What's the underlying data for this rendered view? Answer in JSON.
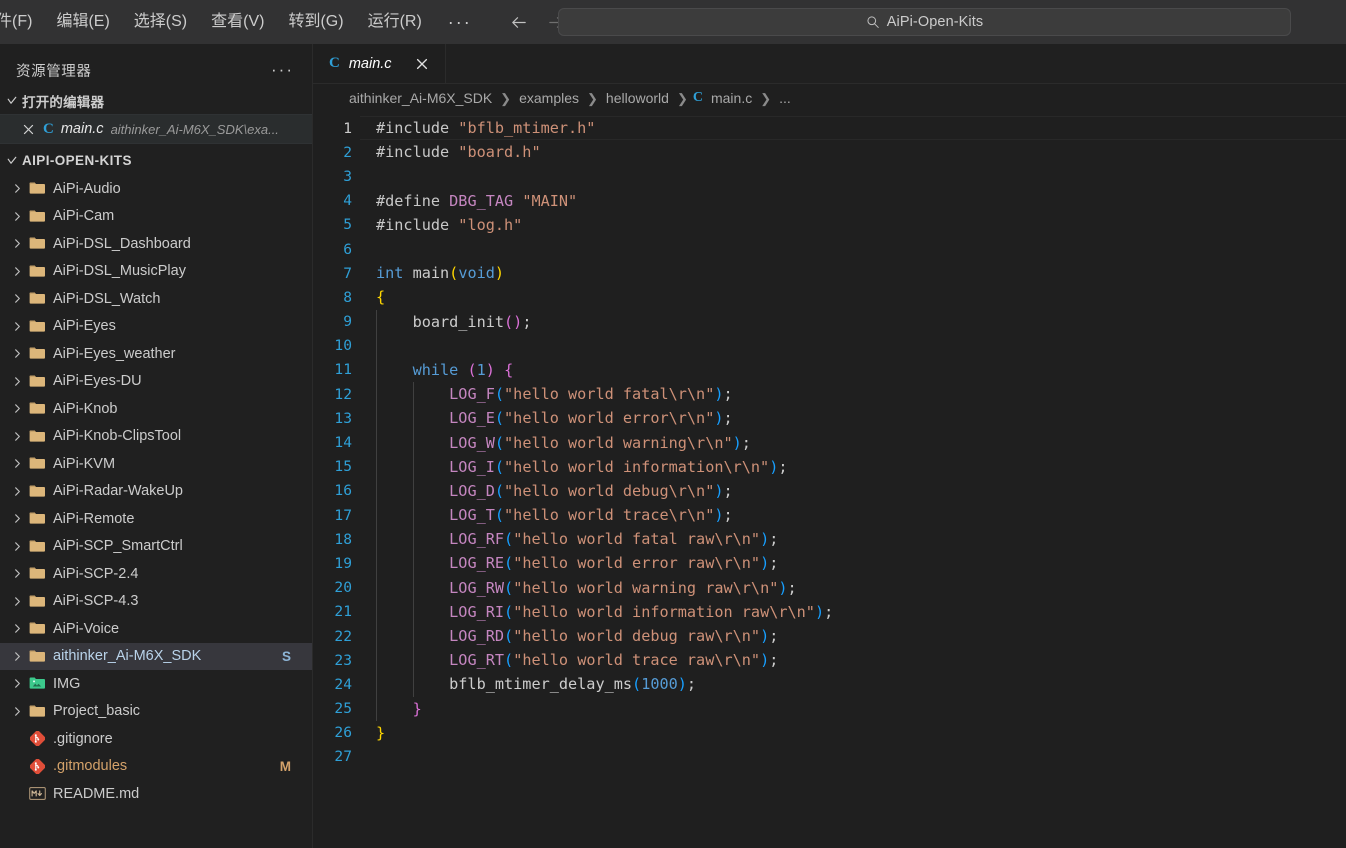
{
  "titlebar": {
    "menus": [
      "件(F)",
      "编辑(E)",
      "选择(S)",
      "查看(V)",
      "转到(G)",
      "运行(R)"
    ],
    "overflow_label": "···",
    "back_icon": "arrow-left-icon",
    "forward_icon": "arrow-right-icon",
    "search": {
      "icon": "search-icon",
      "value": "AiPi-Open-Kits"
    }
  },
  "sidebar": {
    "title": "资源管理器",
    "actions_label": "···",
    "open_editors": {
      "label": "打开的编辑器",
      "items": [
        {
          "name": "main.c",
          "description": "aithinker_Ai-M6X_SDK\\exa...",
          "icon": "c-file-icon",
          "close_icon": "close-icon"
        }
      ]
    },
    "workspace": {
      "label": "AIPI-OPEN-KITS",
      "items": [
        {
          "label": "AiPi-Audio",
          "type": "folder",
          "badge": ""
        },
        {
          "label": "AiPi-Cam",
          "type": "folder",
          "badge": ""
        },
        {
          "label": "AiPi-DSL_Dashboard",
          "type": "folder",
          "badge": ""
        },
        {
          "label": "AiPi-DSL_MusicPlay",
          "type": "folder",
          "badge": ""
        },
        {
          "label": "AiPi-DSL_Watch",
          "type": "folder",
          "badge": ""
        },
        {
          "label": "AiPi-Eyes",
          "type": "folder",
          "badge": ""
        },
        {
          "label": "AiPi-Eyes_weather",
          "type": "folder",
          "badge": ""
        },
        {
          "label": "AiPi-Eyes-DU",
          "type": "folder",
          "badge": ""
        },
        {
          "label": "AiPi-Knob",
          "type": "folder",
          "badge": ""
        },
        {
          "label": "AiPi-Knob-ClipsTool",
          "type": "folder",
          "badge": ""
        },
        {
          "label": "AiPi-KVM",
          "type": "folder",
          "badge": ""
        },
        {
          "label": "AiPi-Radar-WakeUp",
          "type": "folder",
          "badge": ""
        },
        {
          "label": "AiPi-Remote",
          "type": "folder",
          "badge": ""
        },
        {
          "label": "AiPi-SCP_SmartCtrl",
          "type": "folder",
          "badge": ""
        },
        {
          "label": "AiPi-SCP-2.4",
          "type": "folder",
          "badge": ""
        },
        {
          "label": "AiPi-SCP-4.3",
          "type": "folder",
          "badge": ""
        },
        {
          "label": "AiPi-Voice",
          "type": "folder",
          "badge": ""
        },
        {
          "label": "aithinker_Ai-M6X_SDK",
          "type": "folder",
          "badge": "S",
          "selected": true
        },
        {
          "label": "IMG",
          "type": "imgfolder",
          "badge": ""
        },
        {
          "label": "Project_basic",
          "type": "folder",
          "badge": ""
        },
        {
          "label": ".gitignore",
          "type": "git",
          "badge": ""
        },
        {
          "label": ".gitmodules",
          "type": "git",
          "badge": "M",
          "modified": true
        },
        {
          "label": "README.md",
          "type": "markdown",
          "badge": ""
        }
      ]
    }
  },
  "editor": {
    "tabs": [
      {
        "label": "main.c",
        "icon": "c-file-icon",
        "close_icon": "close-icon",
        "active": true
      }
    ],
    "breadcrumb": [
      "aithinker_Ai-M6X_SDK",
      "examples",
      "helloworld",
      "main.c",
      "..."
    ],
    "breadcrumb_separator": "❯",
    "line_count": 27,
    "lines": [
      {
        "n": 1,
        "tokens": [
          {
            "t": "#include ",
            "c": "t-dir"
          },
          {
            "t": "\"bflb_mtimer.h\"",
            "c": "t-str"
          }
        ]
      },
      {
        "n": 2,
        "tokens": [
          {
            "t": "#include ",
            "c": "t-dir"
          },
          {
            "t": "\"board.h\"",
            "c": "t-str"
          }
        ]
      },
      {
        "n": 3,
        "tokens": []
      },
      {
        "n": 4,
        "tokens": [
          {
            "t": "#define ",
            "c": "t-dir"
          },
          {
            "t": "DBG_TAG",
            "c": "t-pre"
          },
          {
            "t": " ",
            "c": "t-plain"
          },
          {
            "t": "\"MAIN\"",
            "c": "t-str"
          }
        ]
      },
      {
        "n": 5,
        "tokens": [
          {
            "t": "#include ",
            "c": "t-dir"
          },
          {
            "t": "\"log.h\"",
            "c": "t-str"
          }
        ]
      },
      {
        "n": 6,
        "tokens": []
      },
      {
        "n": 7,
        "tokens": [
          {
            "t": "int",
            "c": "t-key"
          },
          {
            "t": " main",
            "c": "t-plain"
          },
          {
            "t": "(",
            "c": "t-paren1"
          },
          {
            "t": "void",
            "c": "t-key"
          },
          {
            "t": ")",
            "c": "t-paren1"
          }
        ]
      },
      {
        "n": 8,
        "tokens": [
          {
            "t": "{",
            "c": "t-paren1"
          }
        ]
      },
      {
        "n": 9,
        "tokens": [
          {
            "t": "    board_init",
            "c": "t-plain"
          },
          {
            "t": "(",
            "c": "t-paren2"
          },
          {
            "t": ")",
            "c": "t-paren2"
          },
          {
            "t": ";",
            "c": "t-plain"
          }
        ]
      },
      {
        "n": 10,
        "tokens": []
      },
      {
        "n": 11,
        "tokens": [
          {
            "t": "    ",
            "c": "t-plain"
          },
          {
            "t": "while",
            "c": "t-key"
          },
          {
            "t": " ",
            "c": "t-plain"
          },
          {
            "t": "(",
            "c": "t-paren2"
          },
          {
            "t": "1",
            "c": "t-num"
          },
          {
            "t": ")",
            "c": "t-paren2"
          },
          {
            "t": " ",
            "c": "t-plain"
          },
          {
            "t": "{",
            "c": "t-paren2"
          }
        ]
      },
      {
        "n": 12,
        "tokens": [
          {
            "t": "        ",
            "c": "t-plain"
          },
          {
            "t": "LOG_F",
            "c": "t-macro"
          },
          {
            "t": "(",
            "c": "t-paren3"
          },
          {
            "t": "\"hello world fatal\\r\\n\"",
            "c": "t-str"
          },
          {
            "t": ")",
            "c": "t-paren3"
          },
          {
            "t": ";",
            "c": "t-plain"
          }
        ]
      },
      {
        "n": 13,
        "tokens": [
          {
            "t": "        ",
            "c": "t-plain"
          },
          {
            "t": "LOG_E",
            "c": "t-macro"
          },
          {
            "t": "(",
            "c": "t-paren3"
          },
          {
            "t": "\"hello world error\\r\\n\"",
            "c": "t-str"
          },
          {
            "t": ")",
            "c": "t-paren3"
          },
          {
            "t": ";",
            "c": "t-plain"
          }
        ]
      },
      {
        "n": 14,
        "tokens": [
          {
            "t": "        ",
            "c": "t-plain"
          },
          {
            "t": "LOG_W",
            "c": "t-macro"
          },
          {
            "t": "(",
            "c": "t-paren3"
          },
          {
            "t": "\"hello world warning\\r\\n\"",
            "c": "t-str"
          },
          {
            "t": ")",
            "c": "t-paren3"
          },
          {
            "t": ";",
            "c": "t-plain"
          }
        ]
      },
      {
        "n": 15,
        "tokens": [
          {
            "t": "        ",
            "c": "t-plain"
          },
          {
            "t": "LOG_I",
            "c": "t-macro"
          },
          {
            "t": "(",
            "c": "t-paren3"
          },
          {
            "t": "\"hello world information\\r\\n\"",
            "c": "t-str"
          },
          {
            "t": ")",
            "c": "t-paren3"
          },
          {
            "t": ";",
            "c": "t-plain"
          }
        ]
      },
      {
        "n": 16,
        "tokens": [
          {
            "t": "        ",
            "c": "t-plain"
          },
          {
            "t": "LOG_D",
            "c": "t-macro"
          },
          {
            "t": "(",
            "c": "t-paren3"
          },
          {
            "t": "\"hello world debug\\r\\n\"",
            "c": "t-str"
          },
          {
            "t": ")",
            "c": "t-paren3"
          },
          {
            "t": ";",
            "c": "t-plain"
          }
        ]
      },
      {
        "n": 17,
        "tokens": [
          {
            "t": "        ",
            "c": "t-plain"
          },
          {
            "t": "LOG_T",
            "c": "t-macro"
          },
          {
            "t": "(",
            "c": "t-paren3"
          },
          {
            "t": "\"hello world trace\\r\\n\"",
            "c": "t-str"
          },
          {
            "t": ")",
            "c": "t-paren3"
          },
          {
            "t": ";",
            "c": "t-plain"
          }
        ]
      },
      {
        "n": 18,
        "tokens": [
          {
            "t": "        ",
            "c": "t-plain"
          },
          {
            "t": "LOG_RF",
            "c": "t-macro"
          },
          {
            "t": "(",
            "c": "t-paren3"
          },
          {
            "t": "\"hello world fatal raw\\r\\n\"",
            "c": "t-str"
          },
          {
            "t": ")",
            "c": "t-paren3"
          },
          {
            "t": ";",
            "c": "t-plain"
          }
        ]
      },
      {
        "n": 19,
        "tokens": [
          {
            "t": "        ",
            "c": "t-plain"
          },
          {
            "t": "LOG_RE",
            "c": "t-macro"
          },
          {
            "t": "(",
            "c": "t-paren3"
          },
          {
            "t": "\"hello world error raw\\r\\n\"",
            "c": "t-str"
          },
          {
            "t": ")",
            "c": "t-paren3"
          },
          {
            "t": ";",
            "c": "t-plain"
          }
        ]
      },
      {
        "n": 20,
        "tokens": [
          {
            "t": "        ",
            "c": "t-plain"
          },
          {
            "t": "LOG_RW",
            "c": "t-macro"
          },
          {
            "t": "(",
            "c": "t-paren3"
          },
          {
            "t": "\"hello world warning raw\\r\\n\"",
            "c": "t-str"
          },
          {
            "t": ")",
            "c": "t-paren3"
          },
          {
            "t": ";",
            "c": "t-plain"
          }
        ]
      },
      {
        "n": 21,
        "tokens": [
          {
            "t": "        ",
            "c": "t-plain"
          },
          {
            "t": "LOG_RI",
            "c": "t-macro"
          },
          {
            "t": "(",
            "c": "t-paren3"
          },
          {
            "t": "\"hello world information raw\\r\\n\"",
            "c": "t-str"
          },
          {
            "t": ")",
            "c": "t-paren3"
          },
          {
            "t": ";",
            "c": "t-plain"
          }
        ]
      },
      {
        "n": 22,
        "tokens": [
          {
            "t": "        ",
            "c": "t-plain"
          },
          {
            "t": "LOG_RD",
            "c": "t-macro"
          },
          {
            "t": "(",
            "c": "t-paren3"
          },
          {
            "t": "\"hello world debug raw\\r\\n\"",
            "c": "t-str"
          },
          {
            "t": ")",
            "c": "t-paren3"
          },
          {
            "t": ";",
            "c": "t-plain"
          }
        ]
      },
      {
        "n": 23,
        "tokens": [
          {
            "t": "        ",
            "c": "t-plain"
          },
          {
            "t": "LOG_RT",
            "c": "t-macro"
          },
          {
            "t": "(",
            "c": "t-paren3"
          },
          {
            "t": "\"hello world trace raw\\r\\n\"",
            "c": "t-str"
          },
          {
            "t": ")",
            "c": "t-paren3"
          },
          {
            "t": ";",
            "c": "t-plain"
          }
        ]
      },
      {
        "n": 24,
        "tokens": [
          {
            "t": "        bflb_mtimer_delay_ms",
            "c": "t-plain"
          },
          {
            "t": "(",
            "c": "t-paren3"
          },
          {
            "t": "1000",
            "c": "t-num"
          },
          {
            "t": ")",
            "c": "t-paren3"
          },
          {
            "t": ";",
            "c": "t-plain"
          }
        ]
      },
      {
        "n": 25,
        "tokens": [
          {
            "t": "    ",
            "c": "t-plain"
          },
          {
            "t": "}",
            "c": "t-paren2"
          }
        ]
      },
      {
        "n": 26,
        "tokens": [
          {
            "t": "}",
            "c": "t-paren1"
          }
        ]
      },
      {
        "n": 27,
        "tokens": []
      }
    ]
  },
  "colors": {
    "background": "#1f1f1f",
    "sidebar_bg": "#202020",
    "titlebar_bg": "#323233",
    "accent_blue": "#2f9fd6",
    "folder_amber": "#dcb67a",
    "git_red": "#e04e39",
    "img_green": "#3cc98c",
    "selection_bg": "#37373d",
    "string_orange": "#ce9178",
    "macro_purple": "#c586c0"
  }
}
